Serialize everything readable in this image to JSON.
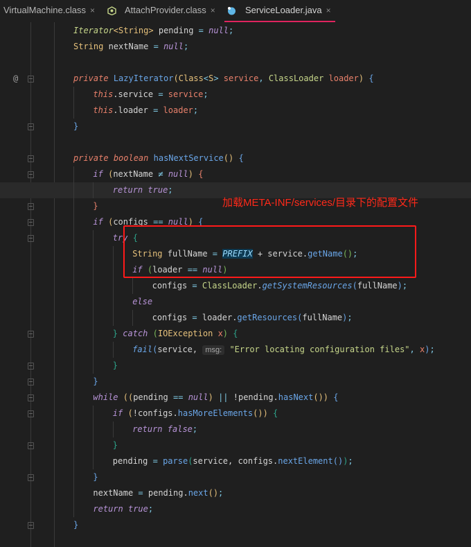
{
  "tabs": [
    {
      "label": "VirtualMachine.class",
      "close": "×",
      "icon": "class-file-icon",
      "active": false
    },
    {
      "label": "AttachProvider.class",
      "close": "×",
      "icon": "interface-class-icon",
      "active": false
    },
    {
      "label": "ServiceLoader.java",
      "close": "×",
      "icon": "java-class-icon",
      "active": true
    }
  ],
  "colors": {
    "accent": "#e0245e",
    "annotation": "#ff2a1a",
    "background": "#1f1f1f"
  },
  "annotation": {
    "text": "加载META-INF/services/目录下的配置文件"
  },
  "gutter": {
    "override_marker": "@"
  },
  "lines": [
    {
      "indent": 0,
      "tokens": [
        [
          "Iterator",
          "itf"
        ],
        [
          "<",
          "p1"
        ],
        [
          "String",
          "ty"
        ],
        [
          ">",
          "p1"
        ],
        [
          " pending ",
          "id"
        ],
        [
          "=",
          "op"
        ],
        [
          " ",
          "id"
        ],
        [
          "null",
          "kw"
        ],
        [
          ";",
          "op"
        ]
      ]
    },
    {
      "indent": 0,
      "tokens": [
        [
          "String",
          "ty"
        ],
        [
          " nextName ",
          "id"
        ],
        [
          "=",
          "op"
        ],
        [
          " ",
          "id"
        ],
        [
          "null",
          "kw"
        ],
        [
          ";",
          "op"
        ]
      ]
    },
    {
      "indent": 0,
      "tokens": []
    },
    {
      "indent": 0,
      "marker": true,
      "fold": true,
      "tokens": [
        [
          "private",
          "mod"
        ],
        [
          " ",
          "id"
        ],
        [
          "LazyIterator",
          "fn"
        ],
        [
          "(",
          "p1"
        ],
        [
          "Class",
          "ty"
        ],
        [
          "<",
          "op"
        ],
        [
          "S",
          "ty"
        ],
        [
          ">",
          "op"
        ],
        [
          " service",
          "par"
        ],
        [
          ", ",
          "op"
        ],
        [
          "ClassLoader",
          "ifc"
        ],
        [
          " loader",
          "par"
        ],
        [
          ")",
          "p1"
        ],
        [
          " ",
          "id"
        ],
        [
          "{",
          "p3"
        ]
      ]
    },
    {
      "indent": 1,
      "tokens": [
        [
          "this",
          "mod"
        ],
        [
          ".service ",
          "id"
        ],
        [
          "=",
          "op"
        ],
        [
          " service",
          "par"
        ],
        [
          ";",
          "op"
        ]
      ]
    },
    {
      "indent": 1,
      "tokens": [
        [
          "this",
          "mod"
        ],
        [
          ".loader ",
          "id"
        ],
        [
          "=",
          "op"
        ],
        [
          " loader",
          "par"
        ],
        [
          ";",
          "op"
        ]
      ]
    },
    {
      "indent": 0,
      "fold": true,
      "tokens": [
        [
          "}",
          "p3"
        ]
      ]
    },
    {
      "indent": 0,
      "tokens": []
    },
    {
      "indent": 0,
      "fold": true,
      "tokens": [
        [
          "private",
          "mod"
        ],
        [
          " ",
          "id"
        ],
        [
          "boolean",
          "mod"
        ],
        [
          " ",
          "id"
        ],
        [
          "hasNextService",
          "fn"
        ],
        [
          "()",
          "p1"
        ],
        [
          " ",
          "id"
        ],
        [
          "{",
          "p3"
        ]
      ]
    },
    {
      "indent": 1,
      "fold": true,
      "tokens": [
        [
          "if",
          "kw"
        ],
        [
          " ",
          "id"
        ],
        [
          "(",
          "p1"
        ],
        [
          "nextName ",
          "id"
        ],
        [
          "≠",
          "op"
        ],
        [
          " ",
          "id"
        ],
        [
          "null",
          "kw"
        ],
        [
          ")",
          "p1"
        ],
        [
          " ",
          "id"
        ],
        [
          "{",
          "par"
        ]
      ]
    },
    {
      "indent": 2,
      "current": true,
      "tokens": [
        [
          "return",
          "kw"
        ],
        [
          " ",
          "id"
        ],
        [
          "true",
          "kw"
        ],
        [
          ";",
          "op"
        ]
      ]
    },
    {
      "indent": 1,
      "fold": true,
      "tokens": [
        [
          "}",
          "par"
        ]
      ]
    },
    {
      "indent": 1,
      "fold": true,
      "tokens": [
        [
          "if",
          "kw"
        ],
        [
          " ",
          "id"
        ],
        [
          "(",
          "p1"
        ],
        [
          "configs ",
          "id"
        ],
        [
          "==",
          "op"
        ],
        [
          " ",
          "id"
        ],
        [
          "null",
          "kw"
        ],
        [
          ")",
          "p1"
        ],
        [
          " ",
          "id"
        ],
        [
          "{",
          "p3"
        ]
      ]
    },
    {
      "indent": 2,
      "fold": true,
      "tokens": [
        [
          "try",
          "kw"
        ],
        [
          " ",
          "id"
        ],
        [
          "{",
          "p4"
        ]
      ]
    },
    {
      "indent": 3,
      "tokens": [
        [
          "String",
          "ty"
        ],
        [
          " fullName ",
          "id"
        ],
        [
          "=",
          "op"
        ],
        [
          " ",
          "id"
        ],
        [
          "PREFIX",
          "const"
        ],
        [
          " + service.",
          "id"
        ],
        [
          "getName",
          "fn"
        ],
        [
          "()",
          "p5"
        ],
        [
          ";",
          "op"
        ]
      ]
    },
    {
      "indent": 3,
      "tokens": [
        [
          "if",
          "kw"
        ],
        [
          " ",
          "id"
        ],
        [
          "(",
          "p5"
        ],
        [
          "loader ",
          "id"
        ],
        [
          "==",
          "op"
        ],
        [
          " ",
          "id"
        ],
        [
          "null",
          "kw"
        ],
        [
          ")",
          "p5"
        ]
      ]
    },
    {
      "indent": 4,
      "tokens": [
        [
          "configs ",
          "id"
        ],
        [
          "=",
          "op"
        ],
        [
          " ",
          "id"
        ],
        [
          "ClassLoader",
          "ifc"
        ],
        [
          ".",
          "id"
        ],
        [
          "getSystemResources",
          "fni"
        ],
        [
          "(",
          "p3"
        ],
        [
          "fullName",
          "id"
        ],
        [
          ")",
          "p3"
        ],
        [
          ";",
          "op"
        ]
      ]
    },
    {
      "indent": 3,
      "tokens": [
        [
          "else",
          "kw"
        ]
      ]
    },
    {
      "indent": 4,
      "tokens": [
        [
          "configs ",
          "id"
        ],
        [
          "=",
          "op"
        ],
        [
          " loader.",
          "id"
        ],
        [
          "getResources",
          "fn"
        ],
        [
          "(",
          "p3"
        ],
        [
          "fullName",
          "id"
        ],
        [
          ")",
          "p3"
        ],
        [
          ";",
          "op"
        ]
      ]
    },
    {
      "indent": 2,
      "fold": true,
      "tokens": [
        [
          "}",
          "p4"
        ],
        [
          " ",
          "id"
        ],
        [
          "catch",
          "kw"
        ],
        [
          " ",
          "id"
        ],
        [
          "(",
          "p5"
        ],
        [
          "IOException",
          "ty"
        ],
        [
          " x",
          "par"
        ],
        [
          ")",
          "p5"
        ],
        [
          " ",
          "id"
        ],
        [
          "{",
          "p4"
        ]
      ]
    },
    {
      "indent": 3,
      "hint": "msg:",
      "tokens": [
        [
          "fail",
          "fni"
        ],
        [
          "(",
          "p3"
        ],
        [
          "service, ",
          "id"
        ],
        [
          "HINT",
          "hint"
        ],
        [
          " ",
          "id"
        ],
        [
          "\"Error locating configuration files\"",
          "str"
        ],
        [
          ", ",
          "op"
        ],
        [
          "x",
          "par"
        ],
        [
          ")",
          "p3"
        ],
        [
          ";",
          "op"
        ]
      ]
    },
    {
      "indent": 2,
      "fold": true,
      "tokens": [
        [
          "}",
          "p4"
        ]
      ]
    },
    {
      "indent": 1,
      "fold": true,
      "tokens": [
        [
          "}",
          "p3"
        ]
      ]
    },
    {
      "indent": 1,
      "fold": true,
      "tokens": [
        [
          "while",
          "kw"
        ],
        [
          " ",
          "id"
        ],
        [
          "((",
          "p1"
        ],
        [
          "pending ",
          "id"
        ],
        [
          "==",
          "op"
        ],
        [
          " ",
          "id"
        ],
        [
          "null",
          "kw"
        ],
        [
          ")",
          "p1"
        ],
        [
          " ",
          "id"
        ],
        [
          "||",
          "op"
        ],
        [
          " !pending.",
          "id"
        ],
        [
          "hasNext",
          "fn"
        ],
        [
          "())",
          "p1"
        ],
        [
          " ",
          "id"
        ],
        [
          "{",
          "p3"
        ]
      ]
    },
    {
      "indent": 2,
      "fold": true,
      "tokens": [
        [
          "if",
          "kw"
        ],
        [
          " ",
          "id"
        ],
        [
          "(",
          "p1"
        ],
        [
          "!configs.",
          "id"
        ],
        [
          "hasMoreElements",
          "fn"
        ],
        [
          "())",
          "p1"
        ],
        [
          " ",
          "id"
        ],
        [
          "{",
          "p4"
        ]
      ]
    },
    {
      "indent": 3,
      "tokens": [
        [
          "return",
          "kw"
        ],
        [
          " ",
          "id"
        ],
        [
          "false",
          "kw"
        ],
        [
          ";",
          "op"
        ]
      ]
    },
    {
      "indent": 2,
      "fold": true,
      "tokens": [
        [
          "}",
          "p4"
        ]
      ]
    },
    {
      "indent": 2,
      "tokens": [
        [
          "pending ",
          "id"
        ],
        [
          "=",
          "op"
        ],
        [
          " ",
          "id"
        ],
        [
          "parse",
          "fn"
        ],
        [
          "(",
          "p4"
        ],
        [
          "service, configs.",
          "id"
        ],
        [
          "nextElement",
          "fn"
        ],
        [
          "()",
          "p3"
        ],
        [
          ")",
          "p4"
        ],
        [
          ";",
          "op"
        ]
      ]
    },
    {
      "indent": 1,
      "fold": true,
      "tokens": [
        [
          "}",
          "p3"
        ]
      ]
    },
    {
      "indent": 1,
      "tokens": [
        [
          "nextName ",
          "id"
        ],
        [
          "=",
          "op"
        ],
        [
          " pending.",
          "id"
        ],
        [
          "next",
          "fn"
        ],
        [
          "()",
          "p1"
        ],
        [
          ";",
          "op"
        ]
      ]
    },
    {
      "indent": 1,
      "tokens": [
        [
          "return",
          "kw"
        ],
        [
          " ",
          "id"
        ],
        [
          "true",
          "kw"
        ],
        [
          ";",
          "op"
        ]
      ]
    },
    {
      "indent": 0,
      "fold": true,
      "tokens": [
        [
          "}",
          "p3"
        ]
      ]
    }
  ]
}
